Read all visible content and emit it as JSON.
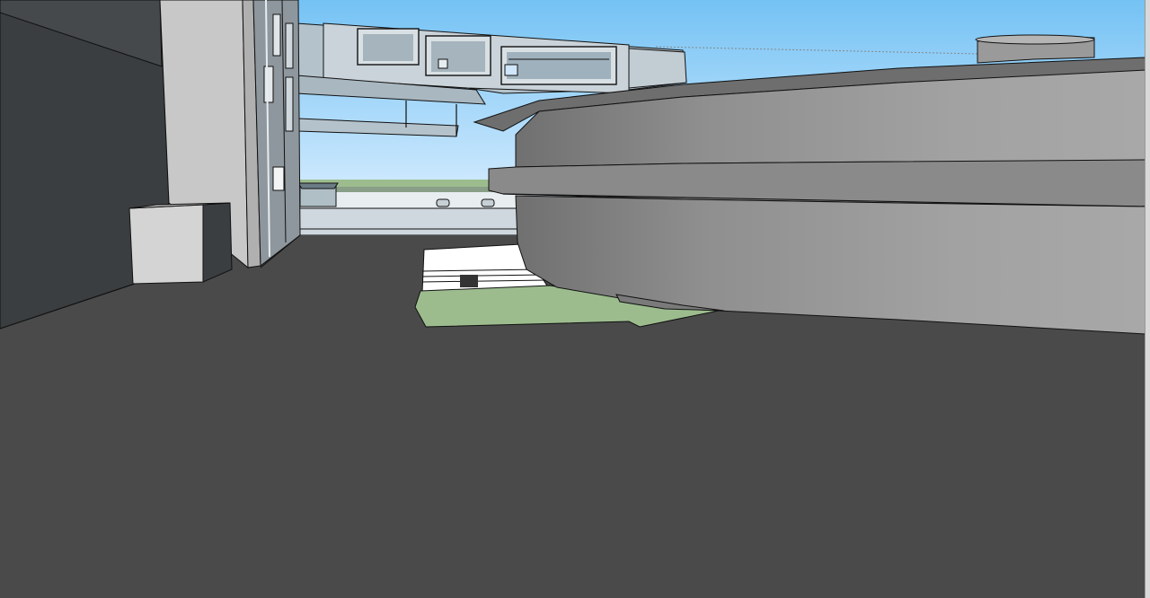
{
  "app": {
    "view": "3d-model-viewport",
    "mode": "perspective"
  },
  "colors": {
    "sky_top": "#74c2f4",
    "sky_bottom": "#dcefff",
    "ground": "#4a4a4a",
    "lawn": "#9cbc8e",
    "facade_light": "#c9d2d8",
    "facade_mid": "#a9b7c0",
    "wall_dark": "#3b3e41",
    "cylinder": "#9a9a9a",
    "edge": "#111111"
  }
}
